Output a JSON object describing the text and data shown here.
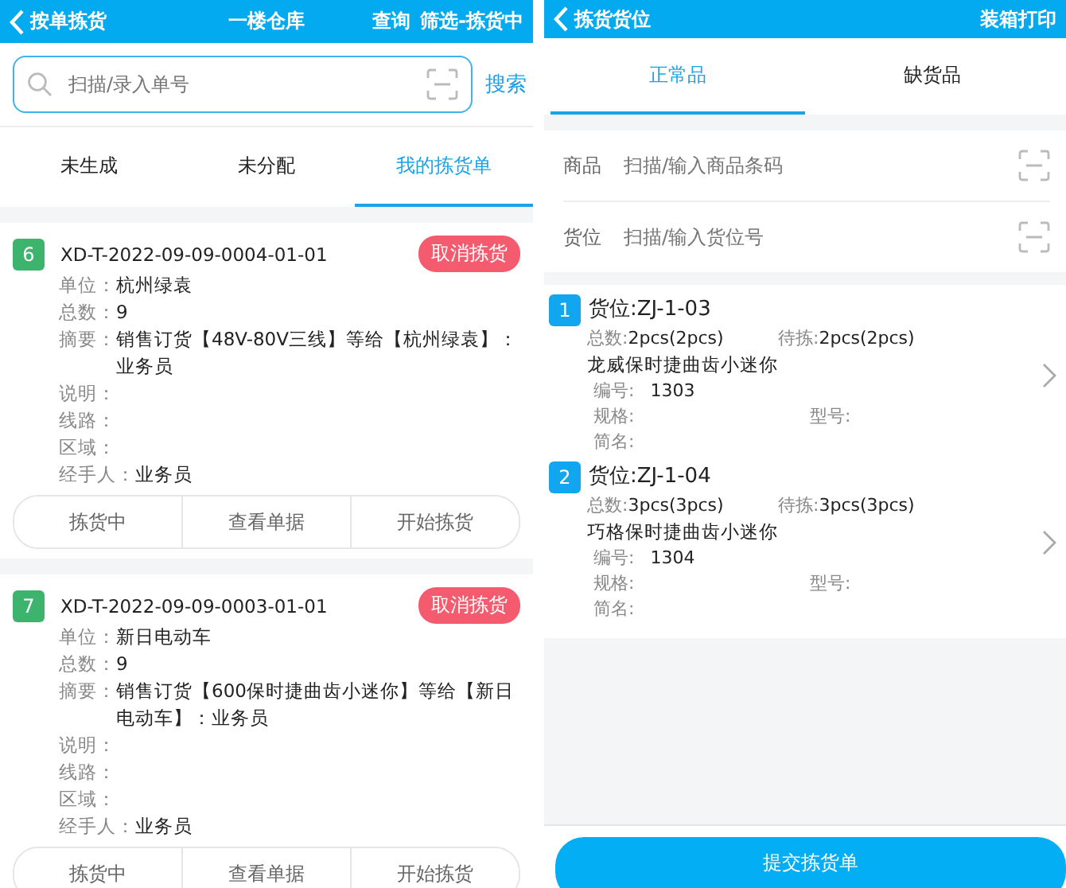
{
  "left": {
    "header": {
      "back_label": "按单拣货",
      "title": "一楼仓库",
      "actions": [
        "查询",
        "筛选-拣货中"
      ]
    },
    "search": {
      "placeholder": "扫描/录入单号",
      "button": "搜索"
    },
    "tabs": [
      {
        "label": "未生成",
        "selected": false
      },
      {
        "label": "未分配",
        "selected": false
      },
      {
        "label": "我的拣货单",
        "selected": true
      }
    ],
    "orders": [
      {
        "index": "6",
        "number": "XD-T-2022-09-09-0004-01-01",
        "cancel": "取消拣货",
        "fields": [
          {
            "label": "单位：",
            "value": "杭州绿袁"
          },
          {
            "label": "总数：",
            "value": "9"
          },
          {
            "label": "摘要：",
            "value": "销售订货【48V-80V三线】等给【杭州绿袁】：业务员"
          },
          {
            "label": "说明："
          },
          {
            "label": "线路："
          },
          {
            "label": "区域："
          },
          {
            "label": "经手人：",
            "value": "业务员"
          }
        ],
        "actions": [
          "拣货中",
          "查看单据",
          "开始拣货"
        ]
      },
      {
        "index": "7",
        "number": "XD-T-2022-09-09-0003-01-01",
        "cancel": "取消拣货",
        "fields": [
          {
            "label": "单位：",
            "value": "新日电动车"
          },
          {
            "label": "总数：",
            "value": "9"
          },
          {
            "label": "摘要：",
            "value": "销售订货【600保时捷曲齿小迷你】等给【新日电动车】：业务员"
          },
          {
            "label": "说明："
          },
          {
            "label": "线路："
          },
          {
            "label": "区域："
          },
          {
            "label": "经手人：",
            "value": "业务员"
          }
        ],
        "actions": [
          "拣货中",
          "查看单据",
          "开始拣货"
        ]
      }
    ]
  },
  "right": {
    "header": {
      "back_label": "拣货货位",
      "action": "装箱打印"
    },
    "tabs": [
      {
        "label": "正常品",
        "selected": true
      },
      {
        "label": "缺货品",
        "selected": false
      }
    ],
    "inputs": [
      {
        "label": "商品",
        "placeholder": "扫描/输入商品条码"
      },
      {
        "label": "货位",
        "placeholder": "扫描/输入货位号"
      }
    ],
    "locations": [
      {
        "index": "1",
        "location": "货位:ZJ-1-03",
        "total_label": "总数:",
        "total": "2pcs(2pcs)",
        "pending_label": "待拣:",
        "pending": "2pcs(2pcs)",
        "product": "龙威保时捷曲齿小迷你",
        "detail_rows": [
          [
            {
              "label": "编号:",
              "value": "1303"
            }
          ],
          [
            {
              "label": "规格:"
            },
            {
              "label": "型号:"
            }
          ],
          [
            {
              "label": "简名:"
            }
          ]
        ]
      },
      {
        "index": "2",
        "location": "货位:ZJ-1-04",
        "total_label": "总数:",
        "total": "3pcs(3pcs)",
        "pending_label": "待拣:",
        "pending": "3pcs(3pcs)",
        "product": "巧格保时捷曲齿小迷你",
        "detail_rows": [
          [
            {
              "label": "编号:",
              "value": "1304"
            }
          ],
          [
            {
              "label": "规格:"
            },
            {
              "label": "型号:"
            }
          ],
          [
            {
              "label": "简名:"
            }
          ]
        ]
      }
    ],
    "submit": "提交拣货单"
  }
}
